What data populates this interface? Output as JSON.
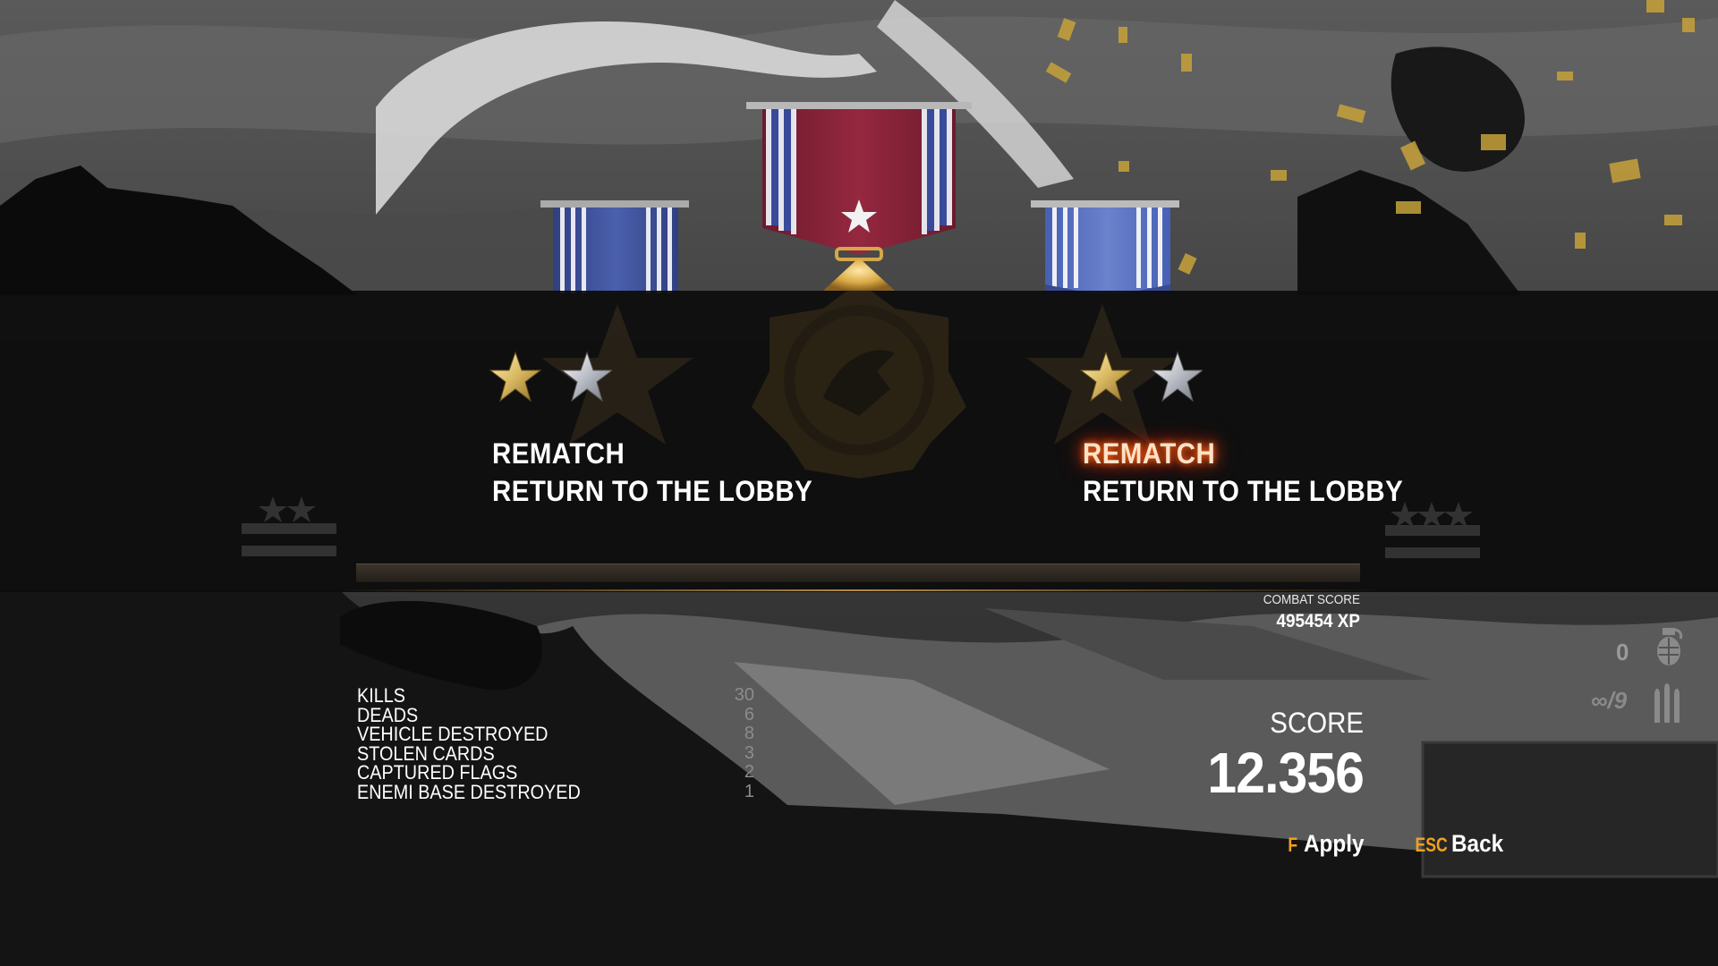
{
  "menus": [
    {
      "items": [
        {
          "label": "REMATCH",
          "active": false
        },
        {
          "label": "RETURN TO THE LOBBY",
          "active": false
        }
      ]
    },
    {
      "items": [
        {
          "label": "REMATCH",
          "active": true
        },
        {
          "label": "RETURN TO THE LOBBY",
          "active": false
        }
      ]
    }
  ],
  "combat_score": {
    "label": "COMBAT SCORE",
    "value": "495454 XP"
  },
  "stats": [
    {
      "name": "KILLS",
      "value": "30"
    },
    {
      "name": "DEADS",
      "value": "6"
    },
    {
      "name": "VEHICLE DESTROYED",
      "value": "8"
    },
    {
      "name": "STOLEN CARDS",
      "value": "3"
    },
    {
      "name": "CAPTURED FLAGS",
      "value": "2"
    },
    {
      "name": "ENEMI BASE DESTROYED",
      "value": "1"
    }
  ],
  "score": {
    "label": "SCORE",
    "value": "12.356"
  },
  "controls": {
    "apply": {
      "key": "F",
      "label": "Apply"
    },
    "back": {
      "key": "ESC",
      "label": "Back"
    }
  },
  "hud": {
    "grenades": "0",
    "ammo": "∞/9"
  },
  "colors": {
    "accent": "#f0a020",
    "active_glow": "#ff5a10",
    "ribbon_blue": "#4a5ea8",
    "ribbon_red": "#8a2238",
    "gold": "#d4a84a"
  },
  "icons": {
    "medal_center": "eagle-medal-icon",
    "ribbon_left": "blue-ribbon-icon",
    "ribbon_right": "blue-ribbon-icon",
    "grenade": "grenade-icon",
    "bullets": "bullets-icon",
    "stars": "rank-star-icon"
  }
}
